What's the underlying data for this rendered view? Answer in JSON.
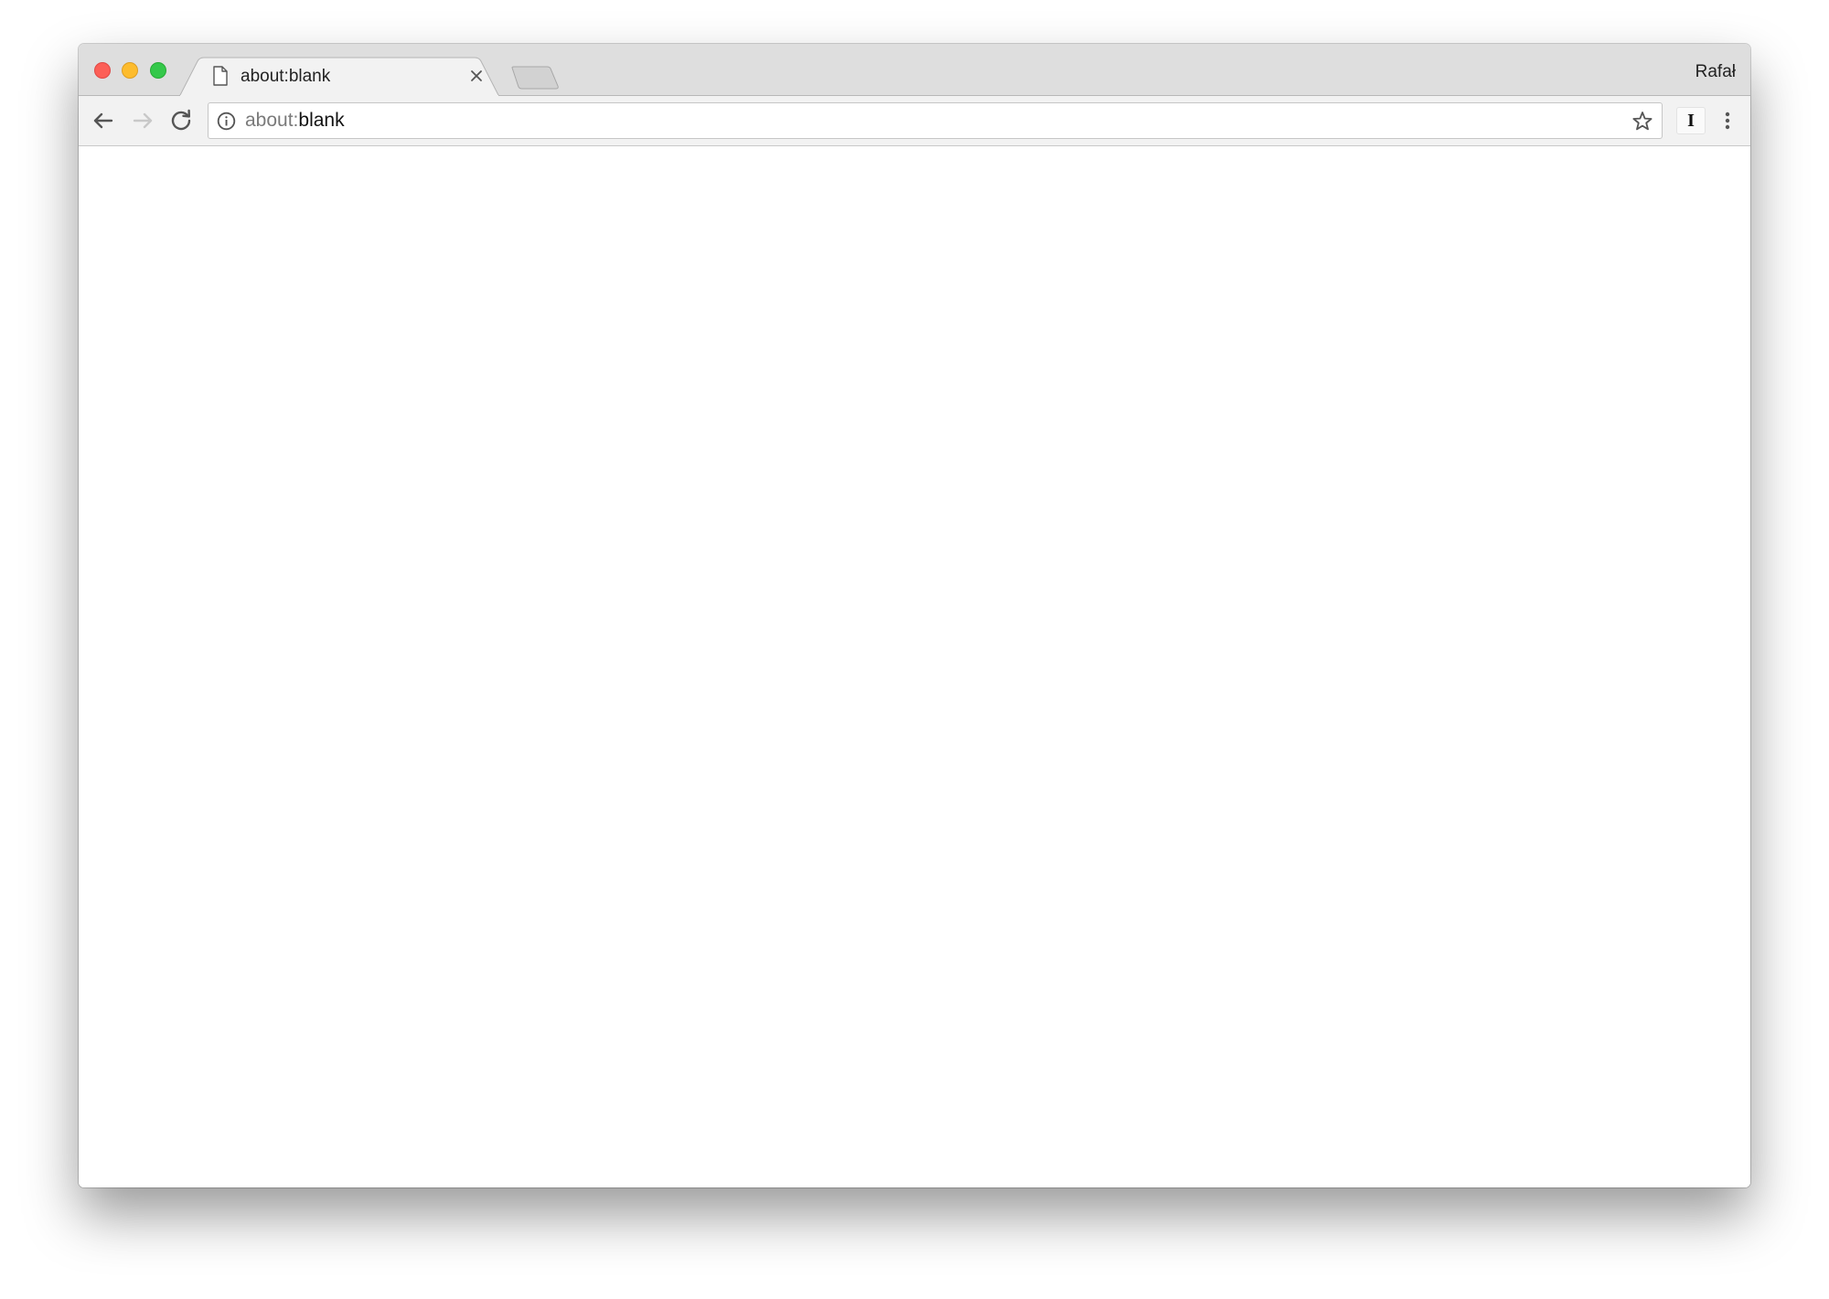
{
  "browser": {
    "tab": {
      "title": "about:blank",
      "icon": "page-icon",
      "close_icon": "close-icon"
    },
    "profile_name": "Rafał",
    "toolbar": {
      "back_icon": "arrow-left-icon",
      "forward_icon": "arrow-right-icon",
      "reload_icon": "reload-icon",
      "address": {
        "scheme": "about:",
        "rest": "blank",
        "info_icon": "info-icon",
        "bookmark_icon": "star-icon"
      },
      "extension_label": "I",
      "menu_icon": "three-dots-vertical-icon"
    }
  },
  "colors": {
    "close": "#fc5f57",
    "minimize": "#fdbc2e",
    "zoom": "#34c84a",
    "titlebar": "#dedede",
    "toolbar": "#f2f2f2"
  }
}
